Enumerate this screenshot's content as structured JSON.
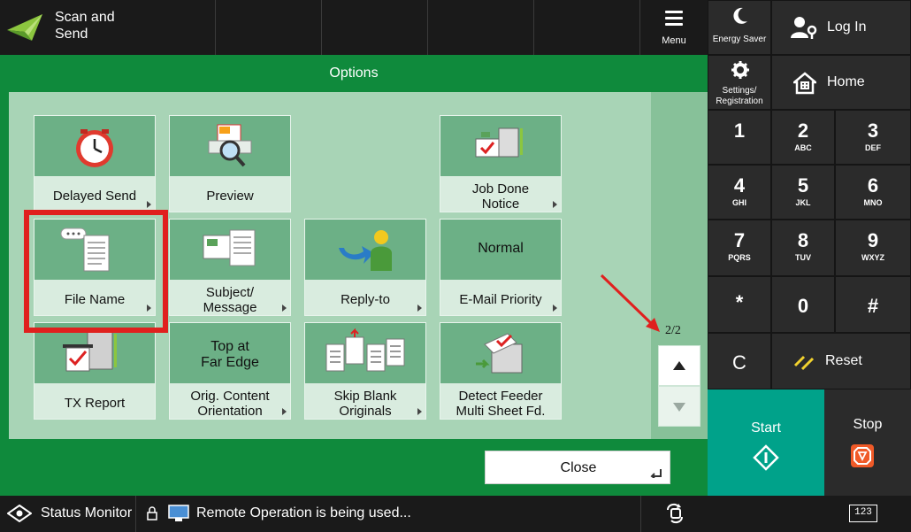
{
  "app": {
    "title_line1": "Scan and",
    "title_line2": "Send"
  },
  "header": {
    "menu_label": "Menu"
  },
  "side": {
    "energy_label": "Energy Saver",
    "login_label": "Log In",
    "settings_line1": "Settings/",
    "settings_line2": "Registration",
    "home_label": "Home"
  },
  "keypad": [
    {
      "digit": "1",
      "sub": ""
    },
    {
      "digit": "2",
      "sub": "ABC"
    },
    {
      "digit": "3",
      "sub": "DEF"
    },
    {
      "digit": "4",
      "sub": "GHI"
    },
    {
      "digit": "5",
      "sub": "JKL"
    },
    {
      "digit": "6",
      "sub": "MNO"
    },
    {
      "digit": "7",
      "sub": "PQRS"
    },
    {
      "digit": "8",
      "sub": "TUV"
    },
    {
      "digit": "9",
      "sub": "WXYZ"
    },
    {
      "digit": "*",
      "sub": ""
    },
    {
      "digit": "0",
      "sub": ""
    },
    {
      "digit": "#",
      "sub": ""
    }
  ],
  "controls": {
    "clear_label": "C",
    "reset_label": "Reset",
    "start_label": "Start",
    "stop_label": "Stop",
    "input_mode": "123"
  },
  "options": {
    "title": "Options",
    "tiles": [
      {
        "line1": "Delayed Send",
        "line2": ""
      },
      {
        "line1": "Preview",
        "line2": ""
      },
      {
        "line1": "Job Done",
        "line2": "Notice"
      },
      {
        "line1": "File Name",
        "line2": ""
      },
      {
        "line1": "Subject/",
        "line2": "Message"
      },
      {
        "line1": "Reply-to",
        "line2": ""
      },
      {
        "line1": "E-Mail Priority",
        "line2": "",
        "value": "Normal"
      },
      {
        "line1": "TX Report",
        "line2": ""
      },
      {
        "line1": "Orig. Content",
        "line2": "Orientation",
        "value_line1": "Top at",
        "value_line2": "Far Edge"
      },
      {
        "line1": "Skip Blank",
        "line2": "Originals"
      },
      {
        "line1": "Detect Feeder",
        "line2": "Multi Sheet Fd."
      }
    ],
    "page_indicator": "2/2",
    "close_label": "Close"
  },
  "status": {
    "monitor_label": "Status Monitor",
    "message": "Remote Operation is being used..."
  },
  "colors": {
    "accent_green": "#0f8a3c",
    "start_teal": "#00a28a",
    "highlight_red": "#e0201e",
    "stop_orange": "#f05a28"
  }
}
